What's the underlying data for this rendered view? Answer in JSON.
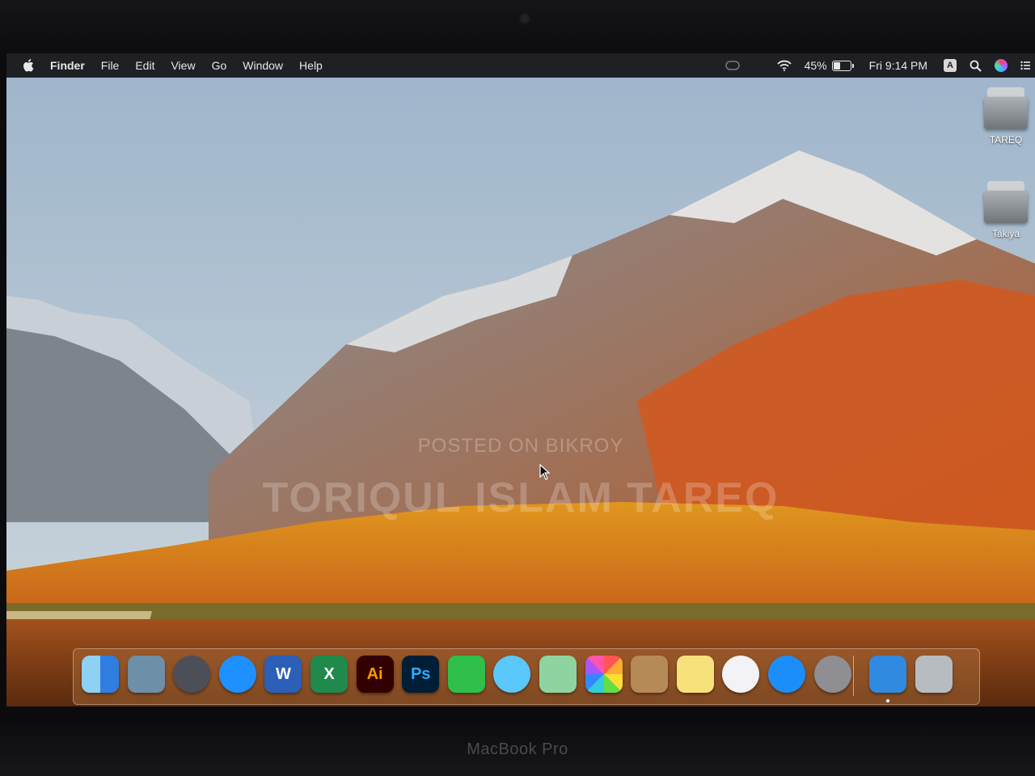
{
  "menubar": {
    "app_name": "Finder",
    "menus": [
      "File",
      "Edit",
      "View",
      "Go",
      "Window",
      "Help"
    ],
    "battery_percent": "45%",
    "battery_level": 0.45,
    "clock": "Fri 9:14 PM",
    "input_source": "A"
  },
  "desktop": {
    "icons": [
      {
        "label": "TAREQ",
        "icon": "external-drive-icon"
      },
      {
        "label": "Takiya",
        "icon": "external-drive-icon"
      }
    ]
  },
  "watermark": {
    "line1": "POSTED ON BIKROY",
    "line2": "TORIQUL ISLAM TAREQ"
  },
  "dock": {
    "apps": [
      {
        "name": "Finder",
        "icon": "finder-icon",
        "color": "#3d8ee8"
      },
      {
        "name": "Preview",
        "icon": "preview-icon",
        "color": "#6e8fa8"
      },
      {
        "name": "Launchpad",
        "icon": "rocket-icon",
        "color": "#4c4f57"
      },
      {
        "name": "Safari",
        "icon": "compass-icon",
        "color": "#1e90ff"
      },
      {
        "name": "Word",
        "icon": "word-icon",
        "glyph": "W",
        "color": "#2b5fb8"
      },
      {
        "name": "Excel",
        "icon": "excel-icon",
        "glyph": "X",
        "color": "#1f8a4c"
      },
      {
        "name": "Illustrator",
        "icon": "illustrator-icon",
        "glyph": "Ai",
        "color": "#330000",
        "glyph_color": "#ff9a00"
      },
      {
        "name": "Photoshop",
        "icon": "photoshop-icon",
        "glyph": "Ps",
        "color": "#001e36",
        "glyph_color": "#31a8ff"
      },
      {
        "name": "FaceTime",
        "icon": "facetime-icon",
        "color": "#2fbf4a"
      },
      {
        "name": "Messages",
        "icon": "messages-icon",
        "color": "#5ac8fa"
      },
      {
        "name": "Maps",
        "icon": "maps-icon",
        "color": "#8fd4a0"
      },
      {
        "name": "Photos",
        "icon": "photos-icon",
        "color": "#f4f4f4"
      },
      {
        "name": "Contacts",
        "icon": "contacts-icon",
        "color": "#b58a57"
      },
      {
        "name": "Notes",
        "icon": "notes-icon",
        "color": "#f7e17a"
      },
      {
        "name": "iTunes",
        "icon": "music-icon",
        "color": "#f2f2f7"
      },
      {
        "name": "App Store",
        "icon": "app-store-icon",
        "color": "#1c8ef9"
      },
      {
        "name": "System Preferences",
        "icon": "gear-icon",
        "color": "#8e8e93"
      },
      {
        "name": "Bluetooth File Exchange",
        "icon": "bluetooth-icon",
        "color": "#2f8ae0"
      },
      {
        "name": "Trash",
        "icon": "trash-icon",
        "color": "#b7bcc0"
      }
    ]
  },
  "hardware": {
    "brand": "MacBook Pro"
  }
}
